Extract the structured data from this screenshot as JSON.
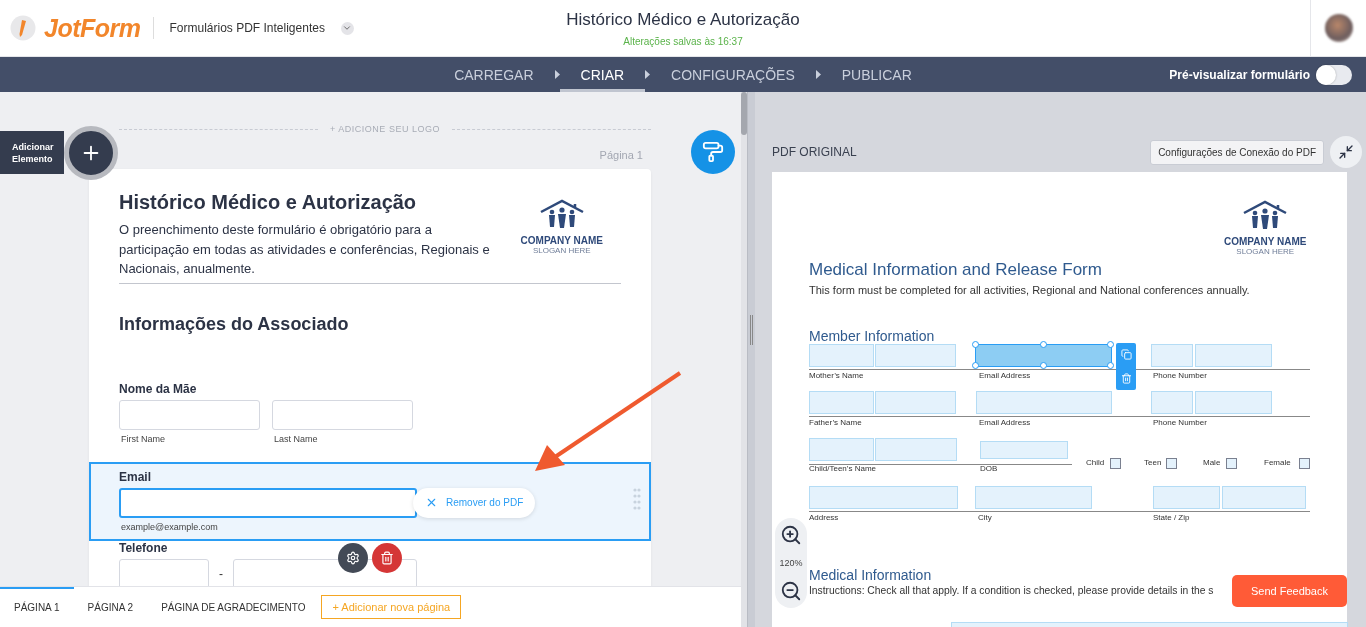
{
  "header": {
    "logo_text": "JotForm",
    "product": "Formulários PDF Inteligentes",
    "title": "Histórico Médico e Autorização",
    "save_status": "Alterações salvas às 16:37"
  },
  "steps": [
    {
      "label": "CARREGAR",
      "selected": false
    },
    {
      "label": "CRIAR",
      "selected": true
    },
    {
      "label": "CONFIGURAÇÕES",
      "selected": false
    },
    {
      "label": "PUBLICAR",
      "selected": false
    }
  ],
  "preview_toggle": {
    "label": "Pré-visualizar formulário",
    "on": false
  },
  "builder": {
    "add_element": "Adicionar Elemento",
    "add_logo": "+ ADICIONE SEU LOGO",
    "page_label": "Página 1"
  },
  "form": {
    "title": "Histórico Médico e Autorização",
    "description": "O preenchimento deste formulário é obrigatório para a participação em todas as atividades e conferências, Regionais e Nacionais, anualmente.",
    "logo": {
      "name": "COMPANY NAME",
      "slogan": "SLOGAN HERE"
    },
    "section_title": "Informações do Associado",
    "fields": [
      {
        "kind": "name",
        "label": "Nome da Mãe",
        "sublabels": [
          "First Name",
          "Last Name"
        ],
        "selected": false
      },
      {
        "kind": "email",
        "label": "Email",
        "sublabel": "example@example.com",
        "remove_label": "Remover do PDF",
        "selected": true
      },
      {
        "kind": "phone",
        "label": "Telefone",
        "separator": "-",
        "selected": false
      }
    ]
  },
  "page_tabs": [
    {
      "label": "PÁGINA 1",
      "selected": true
    },
    {
      "label": "PÁGINA 2",
      "selected": false
    },
    {
      "label": "PÁGINA DE AGRADECIMENTO",
      "selected": false
    }
  ],
  "add_page": "+ Adicionar nova página",
  "pdf": {
    "heading": "PDF ORIGINAL",
    "connection_button": "Configurações de Conexão do PDF",
    "zoom": "120%",
    "logo": {
      "name": "COMPANY NAME",
      "slogan": "SLOGAN HERE"
    },
    "title": "Medical Information and Release Form",
    "subtitle": "This form must be completed for all activities, Regional and National conferences annually.",
    "section": "Member Information",
    "rows": [
      {
        "fields": [
          {
            "label": "Mother’s Name",
            "selected": false
          },
          {
            "label": "Email Address",
            "selected": true
          },
          {
            "label": "Phone Number",
            "selected": false
          }
        ]
      },
      {
        "fields": [
          {
            "label": "Father’s Name",
            "selected": false
          },
          {
            "label": "Email Address",
            "selected": false
          },
          {
            "label": "Phone Number",
            "selected": false
          }
        ]
      },
      {
        "fields": [
          {
            "label": "Child/Teen’s Name",
            "selected": false
          },
          {
            "label": "DOB",
            "selected": false
          }
        ]
      },
      {
        "fields": [
          {
            "label": "Address",
            "selected": false
          },
          {
            "label": "City",
            "selected": false
          },
          {
            "label": "State / Zip",
            "selected": false
          }
        ]
      }
    ],
    "checkboxes": [
      {
        "label": "Child",
        "checked": false
      },
      {
        "label": "Teen",
        "checked": false
      },
      {
        "label": "Male",
        "checked": false
      },
      {
        "label": "Female",
        "checked": false
      }
    ],
    "section2": "Medical Information",
    "instructions": "Instructions: Check all that apply. If a condition is checked, please provide details in the s"
  },
  "feedback": "Send Feedback"
}
